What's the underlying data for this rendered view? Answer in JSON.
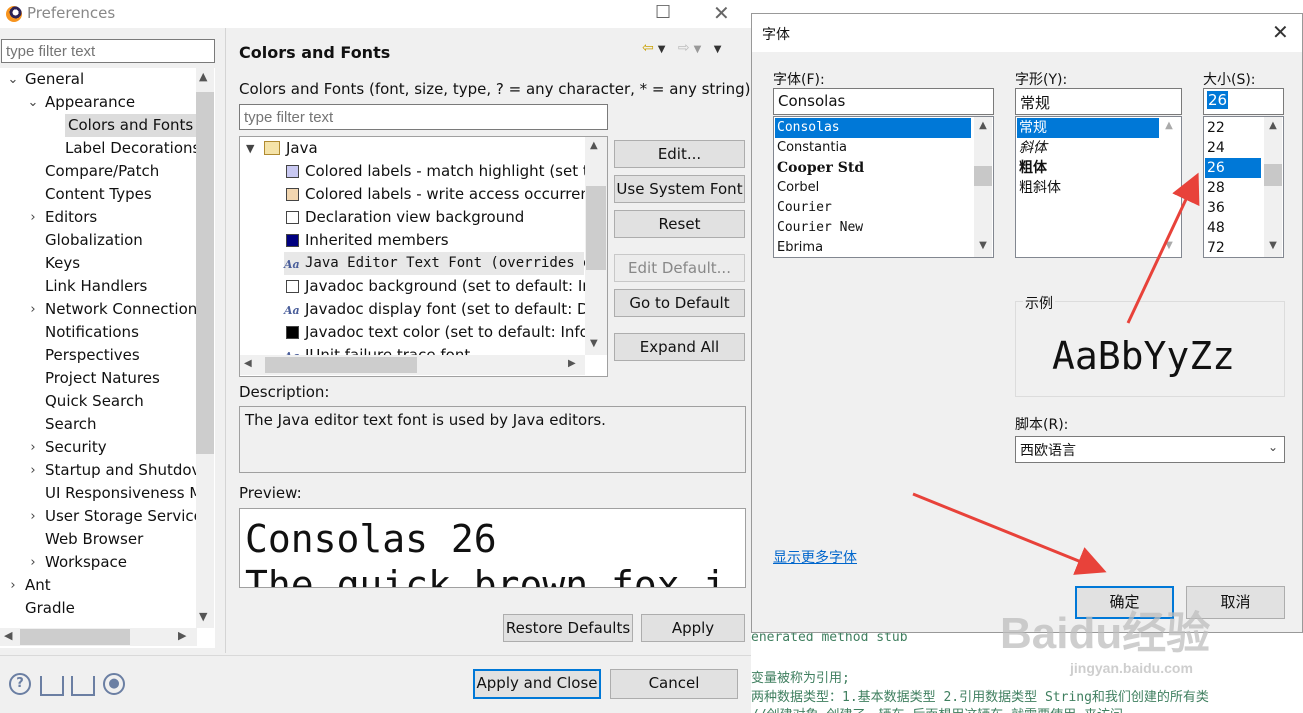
{
  "prefs": {
    "title": "Preferences",
    "filter_placeholder": "type filter text",
    "tree": [
      {
        "label": "General",
        "depth": 0,
        "expanded": true
      },
      {
        "label": "Appearance",
        "depth": 1,
        "expanded": true
      },
      {
        "label": "Colors and Fonts",
        "depth": 2,
        "selected": true
      },
      {
        "label": "Label Decorations",
        "depth": 2
      },
      {
        "label": "Compare/Patch",
        "depth": 1
      },
      {
        "label": "Content Types",
        "depth": 1
      },
      {
        "label": "Editors",
        "depth": 1,
        "collapsed": true
      },
      {
        "label": "Globalization",
        "depth": 1
      },
      {
        "label": "Keys",
        "depth": 1
      },
      {
        "label": "Link Handlers",
        "depth": 1
      },
      {
        "label": "Network Connection",
        "depth": 1,
        "collapsed": true
      },
      {
        "label": "Notifications",
        "depth": 1
      },
      {
        "label": "Perspectives",
        "depth": 1
      },
      {
        "label": "Project Natures",
        "depth": 1
      },
      {
        "label": "Quick Search",
        "depth": 1
      },
      {
        "label": "Search",
        "depth": 1
      },
      {
        "label": "Security",
        "depth": 1,
        "collapsed": true
      },
      {
        "label": "Startup and Shutdov",
        "depth": 1,
        "collapsed": true
      },
      {
        "label": "UI Responsiveness M",
        "depth": 1
      },
      {
        "label": "User Storage Service",
        "depth": 1,
        "collapsed": true
      },
      {
        "label": "Web Browser",
        "depth": 1
      },
      {
        "label": "Workspace",
        "depth": 1,
        "collapsed": true
      },
      {
        "label": "Ant",
        "depth": 0,
        "collapsed": true
      },
      {
        "label": "Gradle",
        "depth": 0
      }
    ],
    "page_title": "Colors and Fonts",
    "page_description": "Colors and Fonts (font, size, type, ? = any character, * = any string) :",
    "fonts_filter_placeholder": "type filter text",
    "fonts_tree": {
      "group": "Java",
      "items": [
        {
          "label": "Colored labels - match highlight (set tc",
          "kind": "swatch",
          "color": "#c9c9f2"
        },
        {
          "label": "Colored labels - write access occurrenc",
          "kind": "swatch",
          "color": "#f2d6b0"
        },
        {
          "label": "Declaration view background",
          "kind": "swatch",
          "color": "#ffffff"
        },
        {
          "label": "Inherited members",
          "kind": "swatch",
          "color": "#000080"
        },
        {
          "label": "Java Editor Text Font (overrides de",
          "kind": "font",
          "selected": true
        },
        {
          "label": "Javadoc background (set to default: Int",
          "kind": "swatch",
          "color": "#ffffff"
        },
        {
          "label": "Javadoc display font (set to default: Dia",
          "kind": "font"
        },
        {
          "label": "Javadoc text color (set to default: Infor",
          "kind": "swatch",
          "color": "#000000"
        },
        {
          "label": "JUnit failure trace font",
          "kind": "font"
        }
      ]
    },
    "buttons": {
      "edit": "Edit...",
      "use_system_font": "Use System Font",
      "reset": "Reset",
      "edit_default": "Edit Default...",
      "go_to_default": "Go to Default",
      "expand_all": "Expand All",
      "restore_defaults": "Restore Defaults",
      "apply": "Apply",
      "apply_and_close": "Apply and Close",
      "cancel": "Cancel"
    },
    "description_label": "Description:",
    "description_text": "The Java editor text font is used by Java editors.",
    "preview_label": "Preview:",
    "preview_line1": "Consolas 26",
    "preview_line2": "The quick brown fox j"
  },
  "font_dialog": {
    "title": "字体",
    "font_label": "字体(F):",
    "font_value": "Consolas",
    "fonts": [
      "Consolas",
      "Constantia",
      "Cooper Std",
      "Corbel",
      "Courier",
      "Courier New",
      "Ebrima"
    ],
    "style_label": "字形(Y):",
    "style_value": "常规",
    "styles": [
      "常规",
      "斜体",
      "粗体",
      "粗斜体"
    ],
    "size_label": "大小(S):",
    "size_value": "26",
    "sizes": [
      "22",
      "24",
      "26",
      "28",
      "36",
      "48",
      "72"
    ],
    "sample_label": "示例",
    "sample_text": "AaBbYyZz",
    "script_label": "脚本(R):",
    "script_value": "西欧语言",
    "more_fonts": "显示更多字体",
    "ok": "确定",
    "cancel": "取消"
  },
  "background_editor": {
    "line1": "enerated method stub",
    "line2": "变量被称为引用;",
    "line3": "两种数据类型：1.基本数据类型  2.引用数据类型  String和我们创建的所有类",
    "line4": "//创建对象 创建了一辆车 后面想用这辆车 就需要使用.来访问"
  },
  "watermark": {
    "text": "Baidu经验",
    "url": "jingyan.baidu.com"
  },
  "colors": {
    "selection": "#0078d7",
    "annotation_arrow": "#e8423a"
  }
}
